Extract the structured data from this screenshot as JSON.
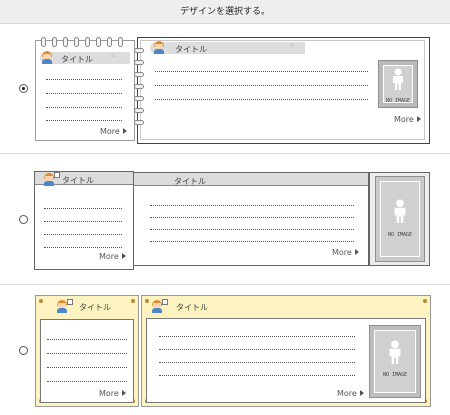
{
  "header": {
    "title": "デザインを選択する。"
  },
  "designs": [
    {
      "left_title": "タイトル",
      "right_title": "タイトル",
      "left_more": "More",
      "right_more": "More",
      "no_image": "NO IMAGE",
      "selected": true
    },
    {
      "left_title": "タイトル",
      "right_title": "タイトル",
      "left_more": "More",
      "right_more": "More",
      "no_image": "NO IMAGE",
      "selected": false
    },
    {
      "left_title": "タイトル",
      "right_title": "タイトル",
      "left_more": "More",
      "right_more": "More",
      "no_image": "NO IMAGE",
      "selected": false
    }
  ],
  "colors": {
    "header_bg": "#efefef",
    "design3_bg": "#fdf3c0",
    "avatar_hair": "#e38a2e",
    "avatar_shirt": "#4f86c6"
  },
  "icons": [
    "radio-button",
    "avatar-icon",
    "person-silhouette-icon",
    "triangle-right-icon"
  ]
}
